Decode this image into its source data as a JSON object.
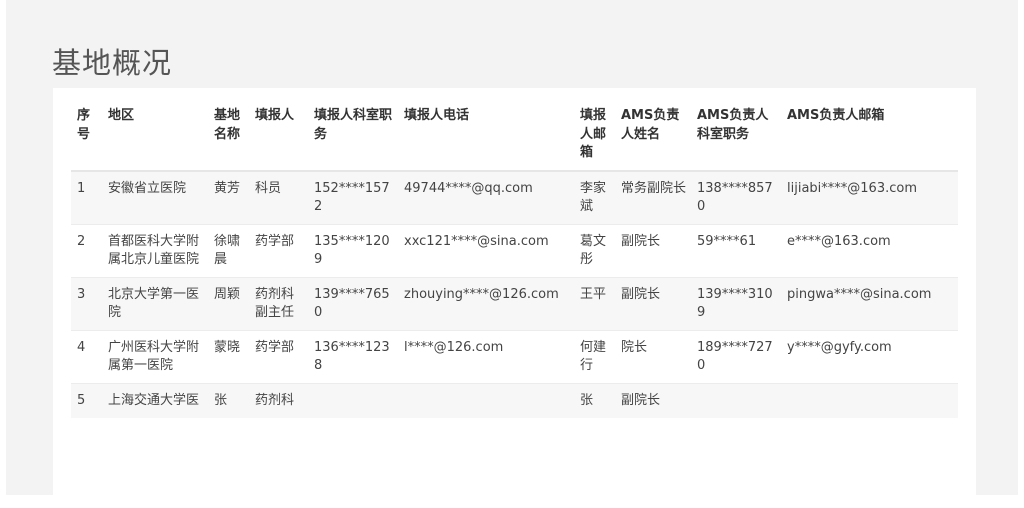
{
  "page_title": "基地概况",
  "table": {
    "headers": [
      "序号",
      "地区",
      "基地名称",
      "填报人",
      "填报人科室职务",
      "填报人电话",
      "填报人邮箱",
      "AMS负责人姓名",
      "AMS负责人科室职务",
      "AMS负责人邮箱"
    ],
    "rows": [
      [
        "1",
        "安徽省立医院",
        "黄芳",
        "科员",
        "152****1572",
        "49744****@qq.com",
        "李家斌",
        "常务副院长",
        "138****8570",
        "lijiabi****@163.com"
      ],
      [
        "2",
        "首都医科大学附属北京儿童医院",
        "徐啸晨",
        "药学部",
        "135****1209",
        "xxc121****@sina.com",
        "葛文彤",
        "副院长",
        "59****61",
        "e****@163.com"
      ],
      [
        "3",
        "北京大学第一医院",
        "周颖",
        "药剂科副主任",
        "139****7650",
        "zhouying****@126.com",
        "王平",
        "副院长",
        "139****3109",
        "pingwa****@sina.com"
      ],
      [
        "4",
        "广州医科大学附属第一医院",
        "蒙晓",
        "药学部",
        "136****1238",
        "l****@126.com",
        "何建行",
        "院长",
        "189****7270",
        "y****@gyfy.com"
      ],
      [
        "5",
        "上海交通大学医",
        "张",
        "药剂科",
        "",
        "",
        "张",
        "副院长",
        "",
        ""
      ]
    ]
  }
}
